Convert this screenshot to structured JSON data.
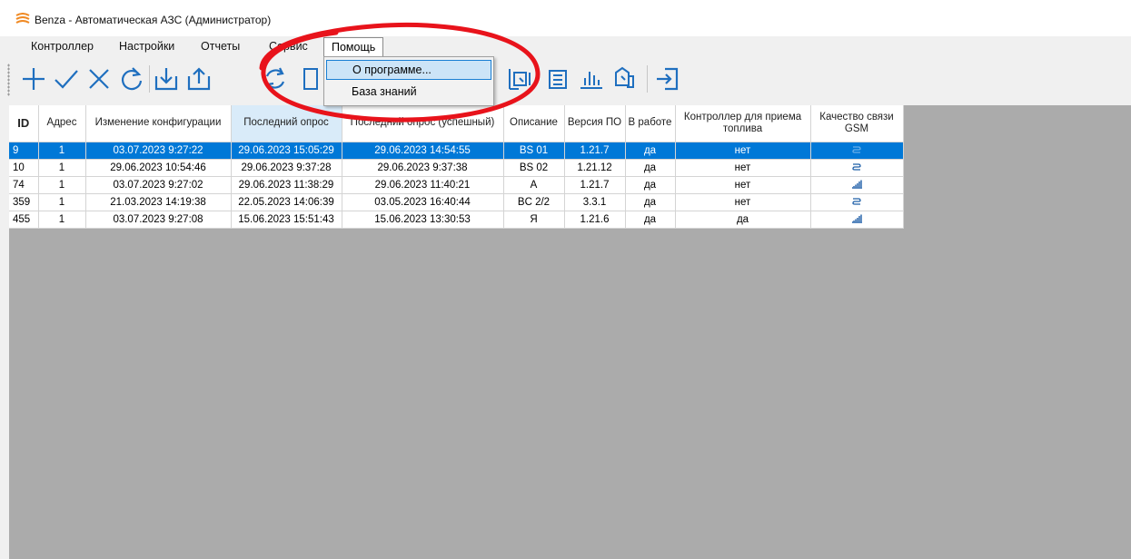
{
  "window": {
    "title": "Benza - Автоматическая АЗС (Администратор)"
  },
  "menu": {
    "controller": "Контроллер",
    "settings": "Настройки",
    "reports": "Отчеты",
    "service": "Сервис",
    "help": "Помощь"
  },
  "help_menu": {
    "about": "О программе...",
    "knowledge_base": "База знаний"
  },
  "toolbar": {
    "icons": [
      "plus-icon",
      "check-icon",
      "close-icon",
      "refresh-icon",
      "download-icon",
      "upload-icon",
      "sync-icon",
      "device-icon",
      "pump-chart-icon",
      "tank-icon",
      "bar-chart-icon",
      "fuel-icon",
      "exit-icon"
    ]
  },
  "grid": {
    "headers": {
      "id": "ID",
      "address": "Адрес",
      "config_change": "Изменение конфигурации",
      "last_poll": "Последний опрос",
      "last_poll_success": "Последний опрос (успешный)",
      "description": "Описание",
      "fw_version": "Версия ПО",
      "in_work": "В работе",
      "fuel_controller": "Контроллер для приема топлива",
      "gsm_quality": "Качество связи GSM"
    },
    "rows": [
      {
        "id": "9",
        "address": "1",
        "config_change": "03.07.2023 9:27:22",
        "last_poll": "29.06.2023 15:05:29",
        "last_poll_success": "29.06.2023 14:54:55",
        "description": "BS 01",
        "fw_version": "1.21.7",
        "in_work": "да",
        "fuel_controller": "нет",
        "gsm": "wire-icon"
      },
      {
        "id": "10",
        "address": "1",
        "config_change": "29.06.2023 10:54:46",
        "last_poll": "29.06.2023 9:37:28",
        "last_poll_success": "29.06.2023 9:37:38",
        "description": "BS 02",
        "fw_version": "1.21.12",
        "in_work": "да",
        "fuel_controller": "нет",
        "gsm": "wire-icon"
      },
      {
        "id": "74",
        "address": "1",
        "config_change": "03.07.2023 9:27:02",
        "last_poll": "29.06.2023 11:38:29",
        "last_poll_success": "29.06.2023 11:40:21",
        "description": "A",
        "fw_version": "1.21.7",
        "in_work": "да",
        "fuel_controller": "нет",
        "gsm": "signal-bars-icon"
      },
      {
        "id": "359",
        "address": "1",
        "config_change": "21.03.2023 14:19:38",
        "last_poll": "22.05.2023 14:06:39",
        "last_poll_success": "03.05.2023 16:40:44",
        "description": "BC 2/2",
        "fw_version": "3.3.1",
        "in_work": "да",
        "fuel_controller": "нет",
        "gsm": "wire-icon"
      },
      {
        "id": "455",
        "address": "1",
        "config_change": "03.07.2023 9:27:08",
        "last_poll": "15.06.2023 15:51:43",
        "last_poll_success": "15.06.2023 13:30:53",
        "description": "Я",
        "fw_version": "1.21.6",
        "in_work": "да",
        "fuel_controller": "да",
        "gsm": "signal-bars-icon"
      }
    ]
  },
  "colors": {
    "selection": "#0078d7",
    "accent": "#1a7fd4",
    "annotation": "#e8131b",
    "app_icon": "#f08a24"
  }
}
